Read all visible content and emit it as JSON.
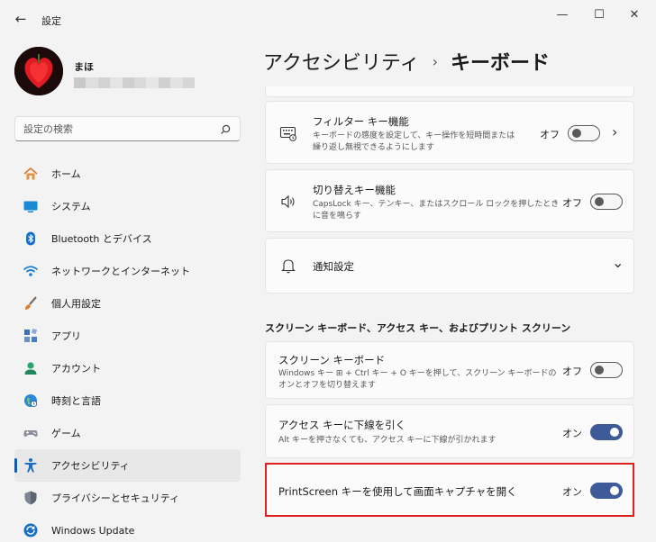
{
  "window": {
    "title": "設定",
    "back_glyph": "←",
    "min_glyph": "—",
    "max_glyph": "☐",
    "close_glyph": "✕"
  },
  "user": {
    "name": "まほ"
  },
  "search": {
    "placeholder": "設定の検索"
  },
  "sidebar": {
    "items": [
      {
        "label": "ホーム",
        "icon": "home-icon",
        "selected": false
      },
      {
        "label": "システム",
        "icon": "system-icon",
        "selected": false
      },
      {
        "label": "Bluetooth とデバイス",
        "icon": "bluetooth-icon",
        "selected": false
      },
      {
        "label": "ネットワークとインターネット",
        "icon": "network-icon",
        "selected": false
      },
      {
        "label": "個人用設定",
        "icon": "personalization-icon",
        "selected": false
      },
      {
        "label": "アプリ",
        "icon": "apps-icon",
        "selected": false
      },
      {
        "label": "アカウント",
        "icon": "account-icon",
        "selected": false
      },
      {
        "label": "時刻と言語",
        "icon": "time-language-icon",
        "selected": false
      },
      {
        "label": "ゲーム",
        "icon": "gaming-icon",
        "selected": false
      },
      {
        "label": "アクセシビリティ",
        "icon": "accessibility-icon",
        "selected": true
      },
      {
        "label": "プライバシーとセキュリティ",
        "icon": "privacy-icon",
        "selected": false
      },
      {
        "label": "Windows Update",
        "icon": "windows-update-icon",
        "selected": false
      }
    ]
  },
  "breadcrumb": {
    "parent": "アクセシビリティ",
    "separator": "›",
    "current": "キーボード"
  },
  "settings": {
    "filter_keys": {
      "title": "フィルター キー機能",
      "desc_line1": "キーボードの感度を設定して、キー操作を短時間または",
      "desc_line2": "繰り返し無視できるようにします",
      "state": "オフ",
      "on": false,
      "chevron": "›"
    },
    "toggle_keys": {
      "title": "切り替えキー機能",
      "desc_line1": "CapsLock キー、テンキー、またはスクロール ロックを押したとき",
      "desc_line2": "に音を鳴らす",
      "state": "オフ",
      "on": false
    },
    "notifications": {
      "title": "通知設定",
      "chevron": "⌄"
    },
    "section_header": "スクリーン キーボード、アクセス キー、およびプリント スクリーン",
    "onscreen_keyboard": {
      "title": "スクリーン キーボード",
      "desc_line1": "Windows キー ⊞ + Ctrl キー + O キーを押して、スクリーン キーボードの",
      "desc_line2": "オンとオフを切り替えます",
      "state": "オフ",
      "on": false
    },
    "access_keys": {
      "title": "アクセス キーに下線を引く",
      "desc_line1": "Alt キーを押さなくても、アクセス キーに下線が引かれます",
      "state": "オン",
      "on": true
    },
    "print_screen": {
      "title": "PrintScreen キーを使用して画面キャプチャを開く",
      "state": "オン",
      "on": true
    }
  },
  "colors": {
    "accent": "#005fb8",
    "toggle_on": "#3e5a99",
    "highlight": "#e02020"
  }
}
